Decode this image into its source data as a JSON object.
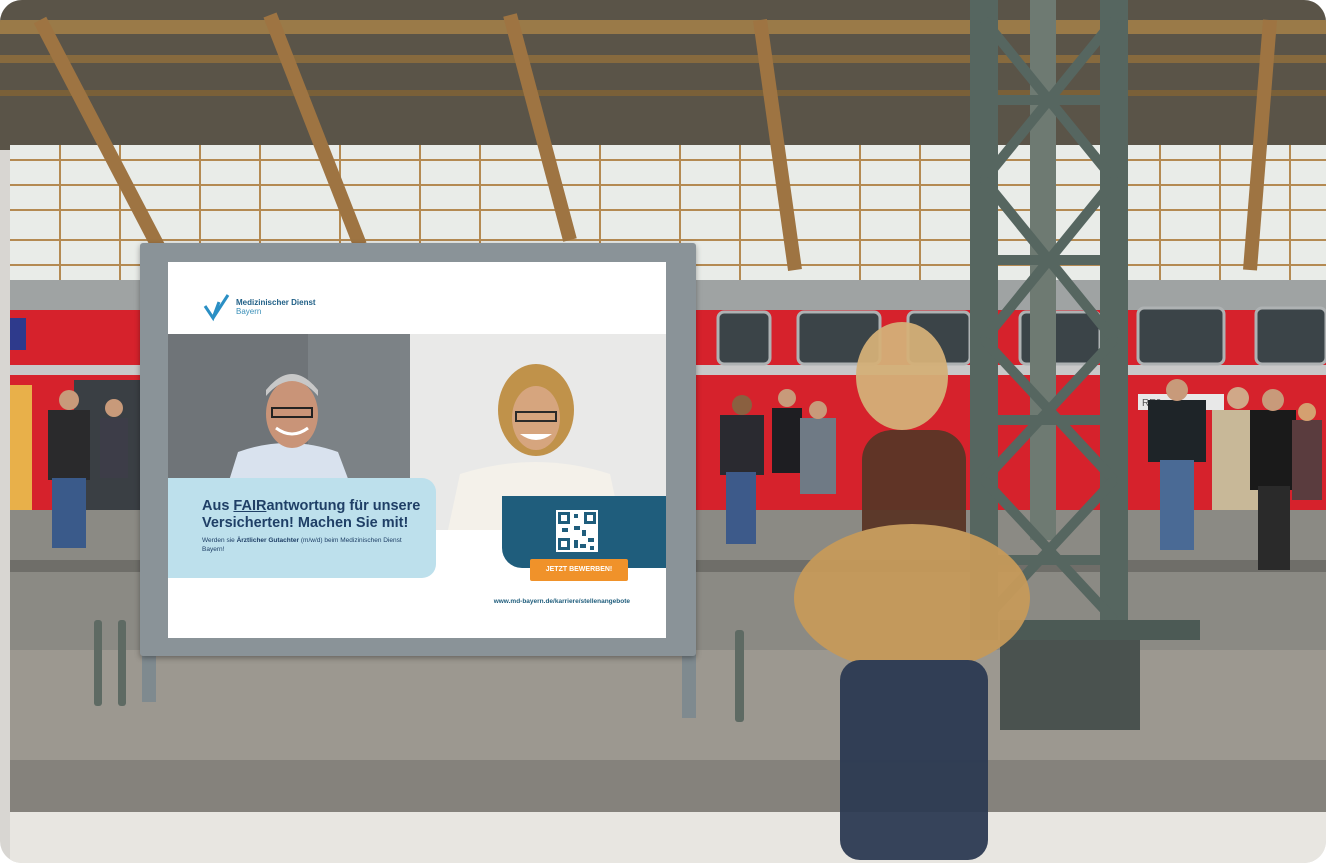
{
  "poster": {
    "logo_line1": "Medizinischer Dienst",
    "logo_line2": "Bayern",
    "headline_part1": "Aus ",
    "headline_underlined": "FAIR",
    "headline_part2": "antwortung für unsere Versicherten! Machen Sie mit!",
    "subline_part1": "Werden sie ",
    "subline_bold": "Ärztlicher Gutachter",
    "subline_part2": " (m/w/d) beim Medizinischen Dienst Bayern!",
    "cta_label": "JETZT BEWERBEN!",
    "url": "www.md-bayern.de/karriere/stellenangebote"
  },
  "station": {
    "train_sign": "RE9"
  },
  "colors": {
    "train_red": "#d6222c",
    "poster_navy": "#1f3f66",
    "poster_teal": "#1f5d7c",
    "poster_light_blue": "#bde0ec",
    "cta_orange": "#f0922a",
    "steel": "#5a6862"
  }
}
